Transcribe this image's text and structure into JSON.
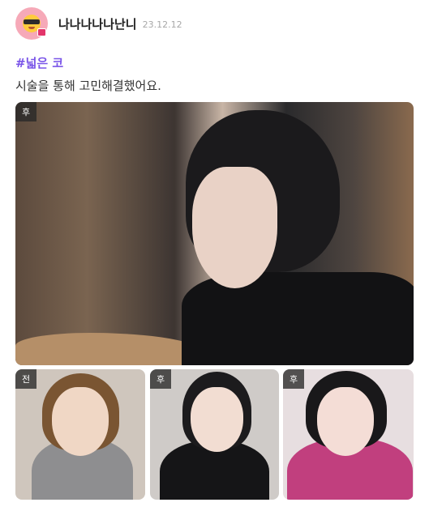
{
  "post": {
    "author": "나나나나나난니",
    "date": "23.12.12",
    "tag": "#넓은 코",
    "text": "시술을 통해 고민해결했어요."
  },
  "images": {
    "main_badge": "후",
    "thumbs": [
      {
        "badge": "전"
      },
      {
        "badge": "후"
      },
      {
        "badge": "후"
      }
    ]
  },
  "colors": {
    "tag": "#7a55e8",
    "avatar_bg": "#f6a9b8"
  },
  "icons": {
    "avatar": "sunglasses-emoji-avatar-icon"
  }
}
